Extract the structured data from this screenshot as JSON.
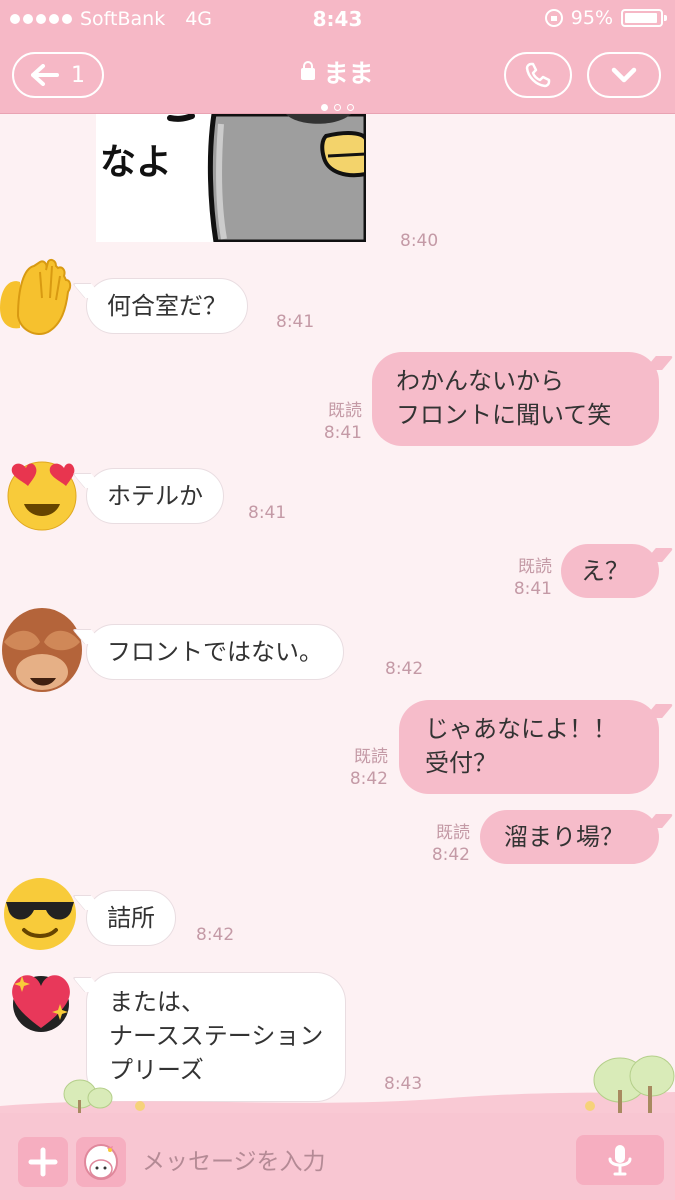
{
  "status_bar": {
    "carrier": "SoftBank",
    "network": "4G",
    "time": "8:43",
    "battery": "95%"
  },
  "header": {
    "back_count": "1",
    "title": "まま",
    "page_count": 3,
    "active_page": 1
  },
  "colors": {
    "header": "#f6b8c6",
    "background": "#fdf1f3",
    "outgoing_bubble": "#f6bcca",
    "incoming_bubble": "#ffffff"
  },
  "messages": [
    {
      "id": "m0",
      "direction": "in",
      "type": "sticker",
      "sticker_text": "なよ",
      "time": "8:40"
    },
    {
      "id": "m1",
      "direction": "in",
      "text": "何合室だ？",
      "time": "8:41",
      "avatar": "raised-hands-icon"
    },
    {
      "id": "m2",
      "direction": "out",
      "text": "わかんないから\nフロントに聞いて笑",
      "time": "8:41",
      "read": "既読"
    },
    {
      "id": "m3",
      "direction": "in",
      "text": "ホテルか",
      "time": "8:41",
      "avatar": "heart-eyes-face-icon"
    },
    {
      "id": "m4",
      "direction": "out",
      "text": "え？",
      "time": "8:41",
      "read": "既読"
    },
    {
      "id": "m5",
      "direction": "in",
      "text": "フロントではない。",
      "time": "8:42",
      "avatar": "see-no-evil-monkey-icon"
    },
    {
      "id": "m6",
      "direction": "out",
      "text": "じゃあなによ！！\n受付？",
      "time": "8:42",
      "read": "既読"
    },
    {
      "id": "m7",
      "direction": "out",
      "text": "溜まり場？",
      "time": "8:42",
      "read": "既読"
    },
    {
      "id": "m8",
      "direction": "in",
      "text": "詰所",
      "time": "8:42",
      "avatar": "sunglasses-face-icon"
    },
    {
      "id": "m9",
      "direction": "in",
      "text": "または、\nナースステーション\nプリーズ",
      "time": "8:43",
      "avatar": "sparkling-heart-icon"
    }
  ],
  "input_bar": {
    "placeholder": "メッセージを入力"
  }
}
